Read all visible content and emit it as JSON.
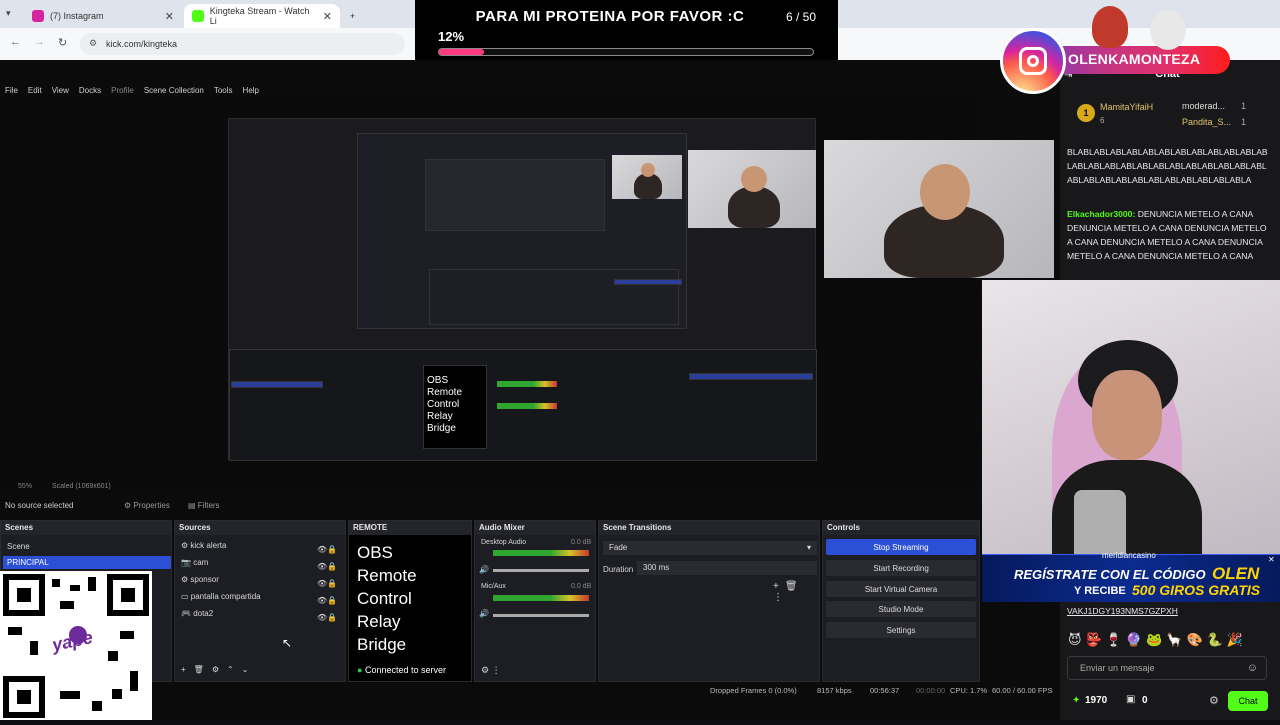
{
  "browser": {
    "tabs": [
      {
        "label": "(7) Instagram",
        "color": "#d6249f"
      },
      {
        "label": "Kingteka Stream - Watch Li",
        "color": "#53fc18"
      }
    ],
    "url": "kick.com/kingteka"
  },
  "goal": {
    "title": "PARA MI PROTEINA POR FAVOR :C",
    "count": "6 / 50",
    "percent_label": "12%",
    "percent_value": 12
  },
  "instagram": {
    "handle": "OLENKAMONTEZA"
  },
  "obs": {
    "menu": [
      "File",
      "Edit",
      "View",
      "Docks",
      "Profile",
      "Scene Collection",
      "Tools",
      "Help"
    ],
    "status_top": {
      "scale": "55%",
      "scaled": "Scaled (1069x601)",
      "no_source": "No source selected",
      "properties": "Properties",
      "filters": "Filters"
    },
    "scenes": {
      "title": "Scenes",
      "items": [
        "Scene",
        "PRINCIPAL"
      ]
    },
    "sources": {
      "title": "Sources",
      "items": [
        "kick alerta",
        "cam",
        "sponsor",
        "pantalla compartida",
        "dota2"
      ]
    },
    "remote": {
      "title": "REMOTE",
      "lines": [
        "OBS",
        "Remote",
        "Control",
        "Relay",
        "Bridge"
      ],
      "status": "Connected to server"
    },
    "audio": {
      "title": "Audio Mixer",
      "desktop": "Desktop Audio",
      "desktop_db": "0.0 dB",
      "mic": "Mic/Aux",
      "mic_db": "0.0 dB",
      "scale": "-60 -55 -50 -45 -40 -35 -30 -25 -20 -15 -10 -5 0"
    },
    "transitions": {
      "title": "Scene Transitions",
      "type": "Fade",
      "duration_label": "Duration",
      "duration_value": "300 ms"
    },
    "controls": {
      "title": "Controls",
      "buttons": [
        "Stop Streaming",
        "Start Recording",
        "Start Virtual Camera",
        "Studio Mode",
        "Settings"
      ]
    },
    "bottom": {
      "dropped": "Dropped Frames 0 (0.0%)",
      "kbps": "8157 kbps",
      "live": "00:56:37",
      "rec": "00:00:00",
      "cpu": "CPU: 1.7%",
      "fps": "60.00 / 60.00 FPS"
    }
  },
  "chat": {
    "title": "Chat",
    "pinned": {
      "user1": "MamitaYifaiH",
      "user1_count": "6",
      "user2": "moderad...",
      "user2_count": "1",
      "user3": "Pandita_S...",
      "user3_count": "1",
      "rank": "1"
    },
    "messages": [
      {
        "user": "",
        "text": "BLABLABLABLABLABLABLABLABLABLABLABLABLABLABLABLABLABLABLABLABLABLABLABLABLABLABLABLABLABLABLABLABLABLABLABLA"
      },
      {
        "user": "Elkachador3000:",
        "text": "DENUNCIA METELO A CANA DENUNCIA METELO A CANA DENUNCIA METELO A CANA DENUNCIA METELO A CANA DENUNCIA METELO A CANA DENUNCIA METELO A CANA"
      }
    ],
    "sponsor_code": "VAKJ1DGY193NMS7GZPXH",
    "input_placeholder": "Enviar un mensaje",
    "points": "1970",
    "gifts": "0",
    "button": "Chat"
  },
  "casino": {
    "brand": "meridiancasino",
    "line1": "REGÍSTRATE CON EL CÓDIGO",
    "code": "OLEN",
    "line2": "Y RECIBE",
    "amount": "500 GIROS GRATIS"
  },
  "qr": {
    "brand": "yape"
  }
}
